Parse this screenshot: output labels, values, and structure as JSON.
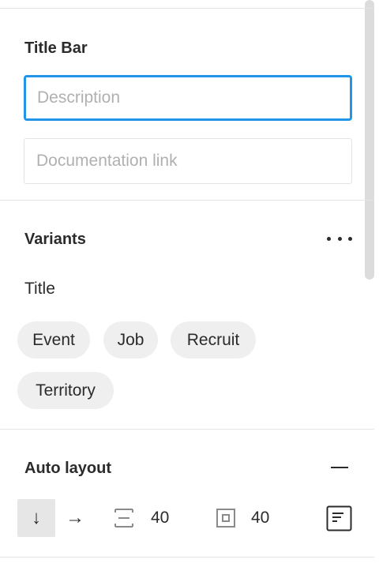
{
  "title_bar": {
    "heading": "Title Bar",
    "description": {
      "value": "",
      "placeholder": "Description"
    },
    "documentation_link": {
      "value": "",
      "placeholder": "Documentation link"
    }
  },
  "variants": {
    "heading": "Variants",
    "more_icon": "more-horizontal-icon",
    "property_name": "Title",
    "options": [
      "Event",
      "Job",
      "Recruit",
      "Territory"
    ]
  },
  "auto_layout": {
    "heading": "Auto layout",
    "remove_icon": "minus-icon",
    "direction_vertical_icon": "↓",
    "direction_horizontal_icon": "→",
    "spacing_value": "40",
    "padding_value": "40",
    "alignment_icon": "align-left-icon"
  },
  "colors": {
    "focus": "#2196e8",
    "chip_bg": "#efefef",
    "active_bg": "#e6e6e6"
  }
}
